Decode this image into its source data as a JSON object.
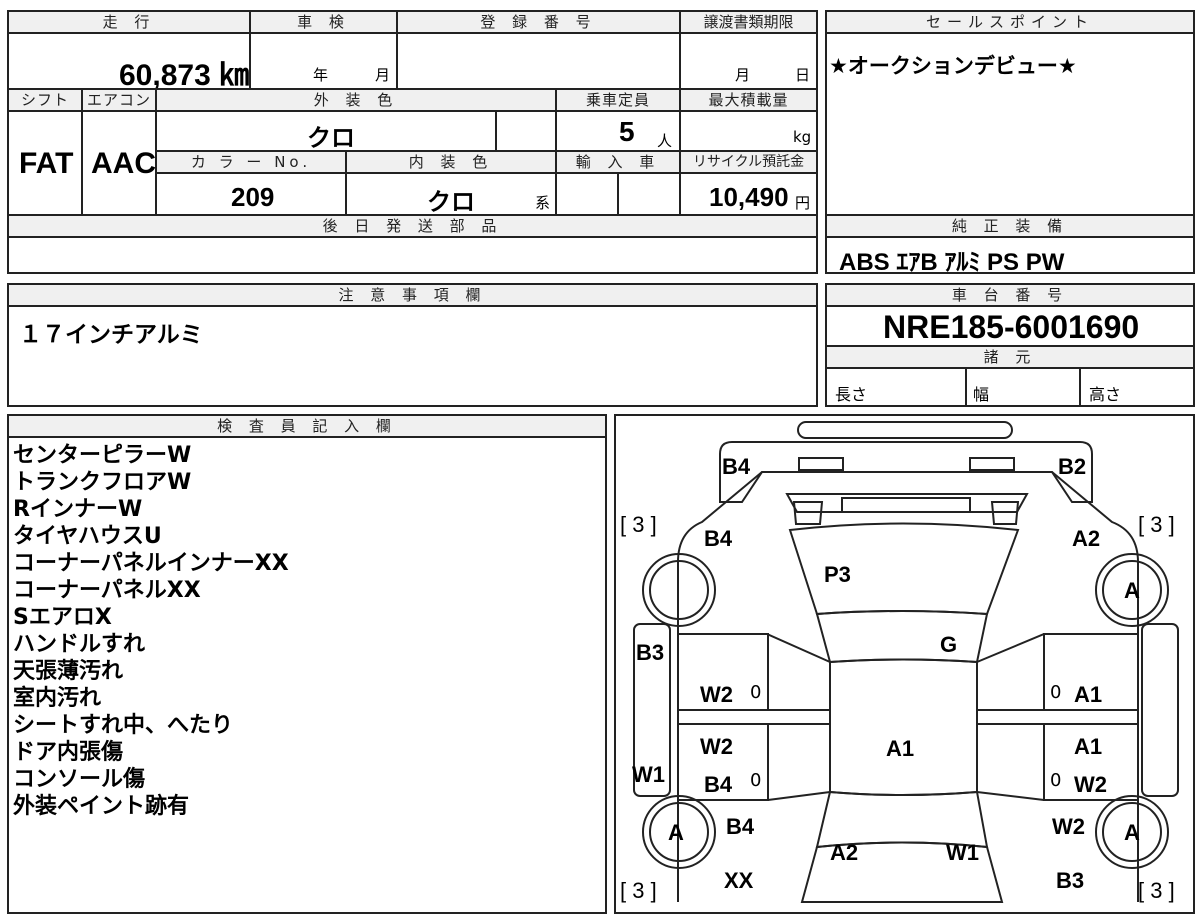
{
  "labels": {
    "mileage": "走 行",
    "inspection": "車 検",
    "registration": "登 録 番 号",
    "transfer_deadline": "譲渡書類期限",
    "shift": "シフト",
    "aircon": "エアコン",
    "exterior_color": "外 装 色",
    "capacity": "乗車定員",
    "max_load": "最大積載量",
    "color_no": "カ ラ ー No.",
    "interior_color": "内 装 色",
    "import": "輸 入 車",
    "recycle": "リサイクル預託金",
    "later_parts": "後 日 発 送 部 品",
    "sales_point": "セールスポイント",
    "standard_equipment": "純 正 装 備",
    "notes": "注 意 事 項 欄",
    "chassis_no": "車 台 番 号",
    "specs": "諸 元",
    "length": "長さ",
    "width": "幅",
    "height": "高さ",
    "inspector": "検 査 員 記 入 欄",
    "year_unit": "年",
    "month_unit": "月",
    "day_unit": "日",
    "persons_unit": "人",
    "kg_unit": "kg",
    "yen_unit": "円",
    "kei_unit": "系"
  },
  "values": {
    "mileage": "60,873 ㎞",
    "shift": "FAT",
    "aircon": "AAC",
    "exterior_color": "クロ",
    "capacity": "5",
    "color_no": "209",
    "interior_color": "クロ",
    "recycle_fee": "10,490",
    "sales_point": "★オークションデビュー★",
    "standard_equipment": "ABS  ｴｱB  ｱﾙﾐ  PS  PW",
    "notes": "１７インチアルミ",
    "chassis_no": "NRE185-6001690"
  },
  "inspector_notes": [
    "センターピラーW",
    "トランクフロアW",
    "RインナーW",
    "タイヤハウスU",
    "コーナーパネルインナーXX",
    "コーナーパネルXX",
    "SエアロX",
    "ハンドルすれ",
    "天張薄汚れ",
    "室内汚れ",
    "シートすれ中、へたり",
    "ドア内張傷",
    "コンソール傷",
    "外装ペイント跡有"
  ],
  "diagram": {
    "tag_b4_top": "B4",
    "tag_b2_top": "B2",
    "tag_3_tl": "[ 3 ]",
    "tag_3_tr": "[ 3 ]",
    "tag_3_bl": "[ 3 ]",
    "tag_3_br": "[ 3 ]",
    "tag_b4_left": "B4",
    "tag_a2_right": "A2",
    "tag_p3": "P3",
    "tag_g": "G",
    "tag_a_fr": "A",
    "tag_a_rl": "A",
    "tag_a_rr": "A",
    "tag_b3_left": "B3",
    "tag_w2_fl": "W2",
    "tag_0_fl": "0",
    "tag_0_fr": "0",
    "tag_a1_fr": "A1",
    "tag_a1_center": "A1",
    "tag_w2_rl": "W2",
    "tag_a1_rr": "A1",
    "tag_w1_left": "W1",
    "tag_b4_rl": "B4",
    "tag_0_rl": "0",
    "tag_0_rr": "0",
    "tag_w2_rr": "W2",
    "tag_b4_rear": "B4",
    "tag_w2_rear_r": "W2",
    "tag_a2_rear": "A2",
    "tag_w1_rear": "W1",
    "tag_xx": "XX",
    "tag_b3_rear": "B3"
  }
}
